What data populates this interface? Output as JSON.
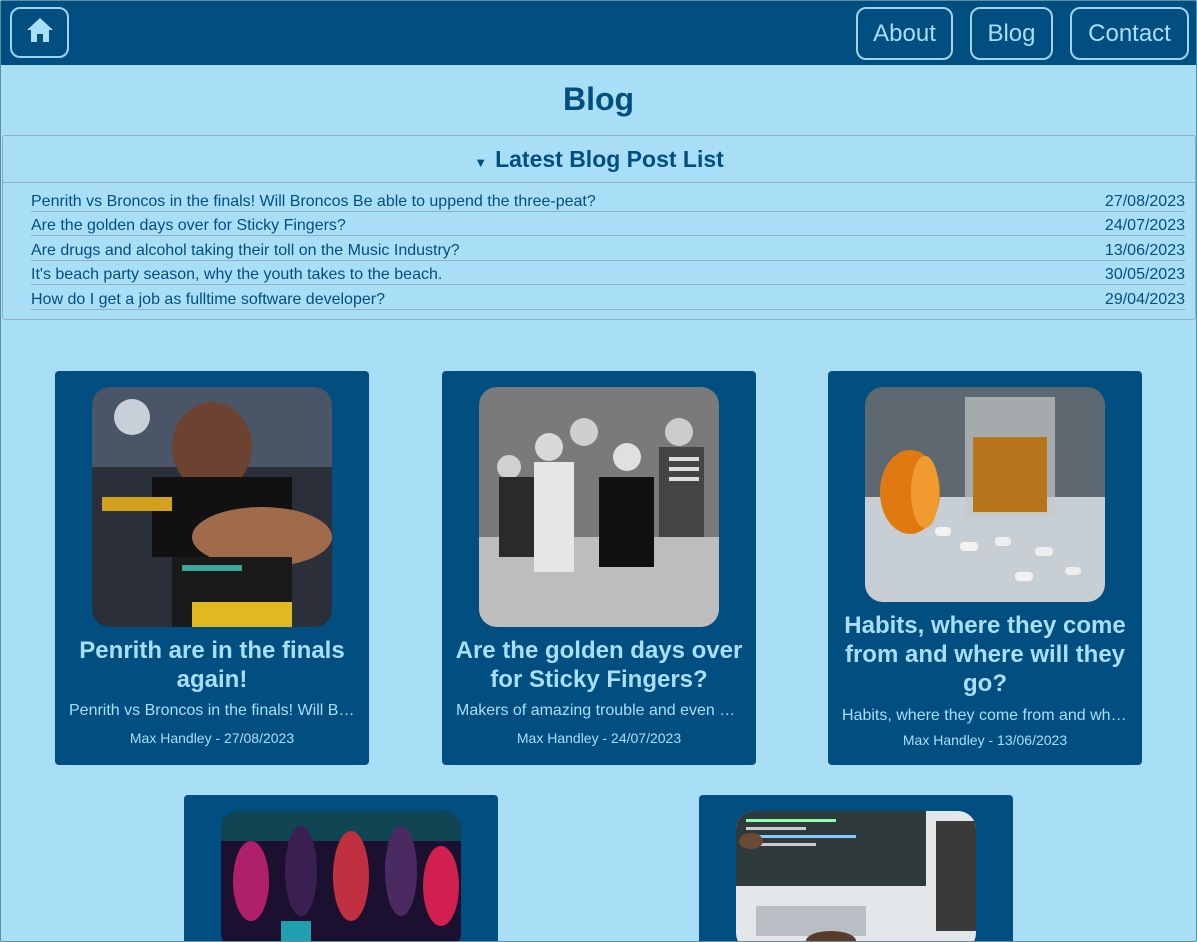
{
  "nav": {
    "home_icon": "home-icon",
    "links": [
      "About",
      "Blog",
      "Contact"
    ]
  },
  "page": {
    "title": "Blog"
  },
  "latest": {
    "heading": "Latest Blog Post List",
    "toggle_glyph": "▼",
    "posts": [
      {
        "title": "Penrith vs Broncos in the finals! Will Broncos Be able to uppend the three-peat?",
        "date": "27/08/2023"
      },
      {
        "title": "Are the golden days over for Sticky Fingers?",
        "date": "24/07/2023"
      },
      {
        "title": "Are drugs and alcohol taking their toll on the Music Industry?",
        "date": "13/06/2023"
      },
      {
        "title": "It's beach party season, why the youth takes to the beach.",
        "date": "30/05/2023"
      },
      {
        "title": "How do I get a job as fulltime software developer?",
        "date": "29/04/2023"
      }
    ]
  },
  "cards": [
    {
      "title": "Penrith are in the finals again!",
      "excerpt": "Penrith vs Broncos in the finals! Will Broncos Be able to uppend the three-peat?",
      "byline": "Max Handley - 27/08/2023"
    },
    {
      "title": "Are the golden days over for Sticky Fingers?",
      "excerpt": "Makers of amazing trouble and even better music",
      "byline": "Max Handley - 24/07/2023"
    },
    {
      "title": "Habits, where they come from and where will they go?",
      "excerpt": "Habits, where they come from and where will they go",
      "byline": "Max Handley - 13/06/2023"
    },
    {
      "title": "",
      "excerpt": "",
      "byline": ""
    },
    {
      "title": "",
      "excerpt": "",
      "byline": ""
    }
  ],
  "colors": {
    "header": "#014f80",
    "background": "#a9def7",
    "accent": "#9fd3ee"
  }
}
